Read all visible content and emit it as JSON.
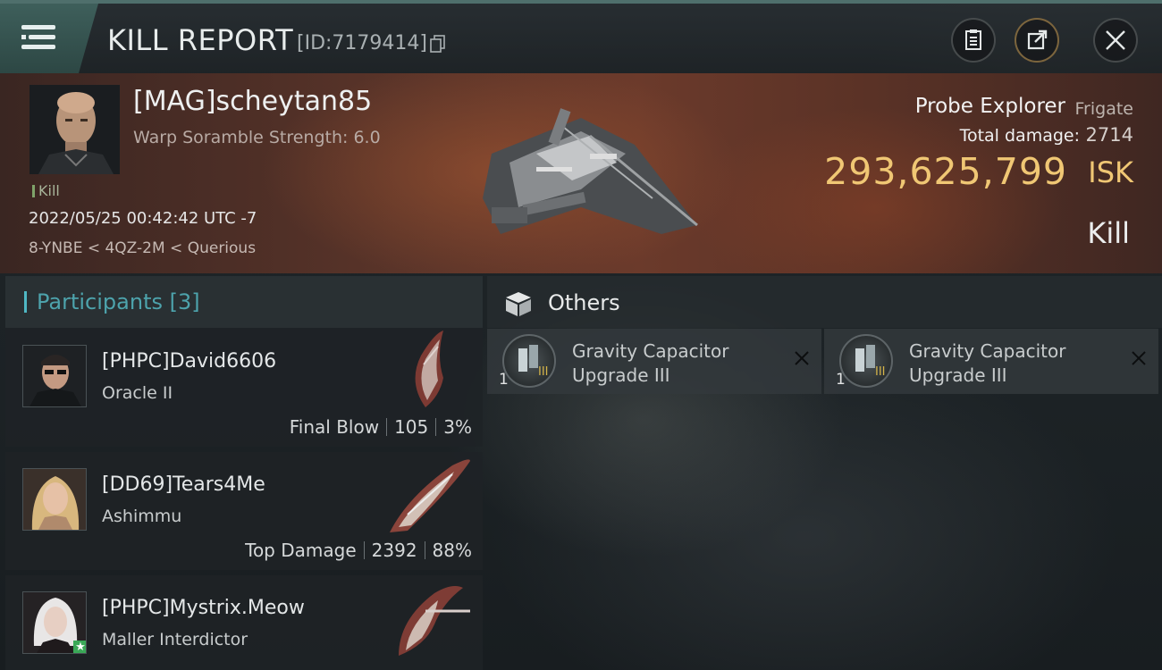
{
  "header": {
    "title": "KILL REPORT",
    "report_id": "[ID:7179414]",
    "icons": [
      "menu-icon",
      "copy-icon",
      "clipboard-icon",
      "share-icon",
      "close-icon"
    ]
  },
  "victim": {
    "name": "[MAG]scheytan85",
    "stat_line": "Warp Soramble Strength: 6.0",
    "tag": "Kill",
    "datetime": "2022/05/25 00:42:42 UTC -7",
    "location": "8-YNBE < 4QZ-2M < Querious",
    "ship_name": "Probe Explorer",
    "ship_class": "Frigate",
    "total_damage_label": "Total damage:",
    "total_damage": "2714",
    "isk_value": "293,625,799",
    "isk_unit": "ISK",
    "result": "Kill"
  },
  "participants": {
    "title": "Participants [3]",
    "list": [
      {
        "name": "[PHPC]David6606",
        "ship": "Oracle II",
        "role": "Final Blow",
        "damage": "105",
        "percent": "3%"
      },
      {
        "name": "[DD69]Tears4Me",
        "ship": "Ashimmu",
        "role": "Top Damage",
        "damage": "2392",
        "percent": "88%"
      },
      {
        "name": "[PHPC]Mystrix.Meow",
        "ship": "Maller Interdictor",
        "badge": "★"
      }
    ]
  },
  "others": {
    "title": "Others",
    "items": [
      {
        "qty": "1",
        "name_line1": "Gravity Capacitor",
        "name_line2": "Upgrade III",
        "tier": "III"
      },
      {
        "qty": "1",
        "name_line1": "Gravity Capacitor",
        "name_line2": "Upgrade III",
        "tier": "III"
      }
    ]
  },
  "colors": {
    "accent_teal": "#4fb8c4",
    "isk_gold": "#f0c774",
    "victim_panel": "#5a3429"
  }
}
